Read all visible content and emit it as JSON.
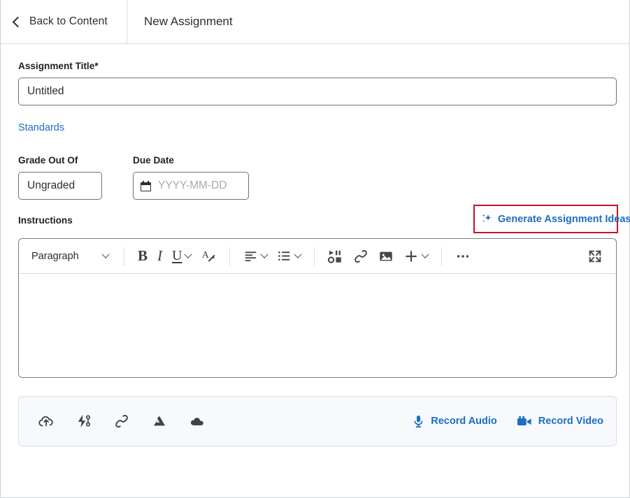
{
  "header": {
    "back_label": "Back to Content",
    "back_icon": "chevron-left-icon",
    "title": "New Assignment"
  },
  "form": {
    "title_field": {
      "label": "Assignment Title",
      "required_marker": "*",
      "value": "Untitled"
    },
    "standards_link": "Standards",
    "grade_field": {
      "label": "Grade Out Of",
      "value": "Ungraded"
    },
    "due_date_field": {
      "label": "Due Date",
      "placeholder": "YYYY-MM-DD",
      "value": "",
      "icon": "calendar-icon"
    },
    "instructions_label": "Instructions"
  },
  "generate_ideas": {
    "label": "Generate Assignment Ideas",
    "icon": "sparkle-icon",
    "highlight_color": "#c8102e",
    "text_color": "#1c6ec2"
  },
  "editor": {
    "toolbar": {
      "format_select": {
        "value": "Paragraph",
        "caret_icon": "chevron-down-icon"
      },
      "buttons": [
        {
          "name": "bold-button",
          "glyph": "B"
        },
        {
          "name": "italic-button",
          "glyph": "I"
        },
        {
          "name": "underline-button",
          "glyph": "U"
        },
        {
          "name": "clear-formatting-button",
          "glyph": "A"
        },
        {
          "name": "align-button",
          "glyph": ""
        },
        {
          "name": "list-button",
          "glyph": ""
        },
        {
          "name": "insert-media-button",
          "glyph": ""
        },
        {
          "name": "insert-link-button",
          "glyph": ""
        },
        {
          "name": "insert-image-button",
          "glyph": ""
        },
        {
          "name": "insert-more-button",
          "glyph": "+"
        },
        {
          "name": "overflow-menu-button",
          "glyph": ""
        },
        {
          "name": "fullscreen-button",
          "glyph": ""
        }
      ]
    },
    "content": "",
    "resize_handle": "resize-handle-icon"
  },
  "attachments": {
    "items": [
      {
        "name": "upload-cloud-icon",
        "label": "Upload"
      },
      {
        "name": "quicklink-icon",
        "label": "Quicklink"
      },
      {
        "name": "link-icon",
        "label": "Link"
      },
      {
        "name": "google-drive-icon",
        "label": "Google Drive"
      },
      {
        "name": "onedrive-icon",
        "label": "OneDrive"
      }
    ],
    "record_audio": {
      "label": "Record Audio",
      "icon": "microphone-icon"
    },
    "record_video": {
      "label": "Record Video",
      "icon": "video-camera-icon"
    }
  },
  "colors": {
    "link_blue": "#1c6ec2",
    "highlight_red": "#c8102e",
    "attach_bar_bg": "#f7f9fc",
    "text": "#2b2d30"
  }
}
